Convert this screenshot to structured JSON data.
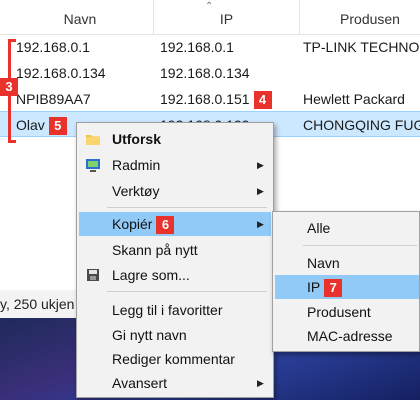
{
  "table": {
    "headers": [
      "Navn",
      "IP",
      "Produsen"
    ],
    "rows": [
      {
        "name": "192.168.0.1",
        "ip": "192.168.0.1",
        "vendor": "TP-LINK TECHNO"
      },
      {
        "name": "192.168.0.134",
        "ip": "192.168.0.134",
        "vendor": ""
      },
      {
        "name": "NPIB89AA7",
        "ip": "192.168.0.151",
        "vendor": "Hewlett Packard"
      },
      {
        "name": "Olav",
        "ip": "192.168.0.199",
        "vendor": "CHONGQING FUG"
      }
    ]
  },
  "badges": {
    "b3": "3",
    "b4": "4",
    "b5": "5",
    "b6": "6",
    "b7": "7"
  },
  "status_text": "y, 250 ukjen",
  "context_menu": {
    "items": [
      "Utforsk",
      "Radmin",
      "Verktøy",
      "Kopiér",
      "Skann på nytt",
      "Lagre som...",
      "Legg til i favoritter",
      "Gi nytt navn",
      "Rediger kommentar",
      "Avansert"
    ]
  },
  "submenu": {
    "items": [
      "Alle",
      "Navn",
      "IP",
      "Produsent",
      "MAC-adresse"
    ]
  },
  "colors": {
    "accent_red": "#e8322b",
    "highlight": "#91c9f7",
    "selection": "#cce8ff"
  },
  "icons": [
    "chevron-up-icon",
    "folder-icon",
    "radmin-icon",
    "save-disk-icon",
    "submenu-arrow-icon"
  ]
}
